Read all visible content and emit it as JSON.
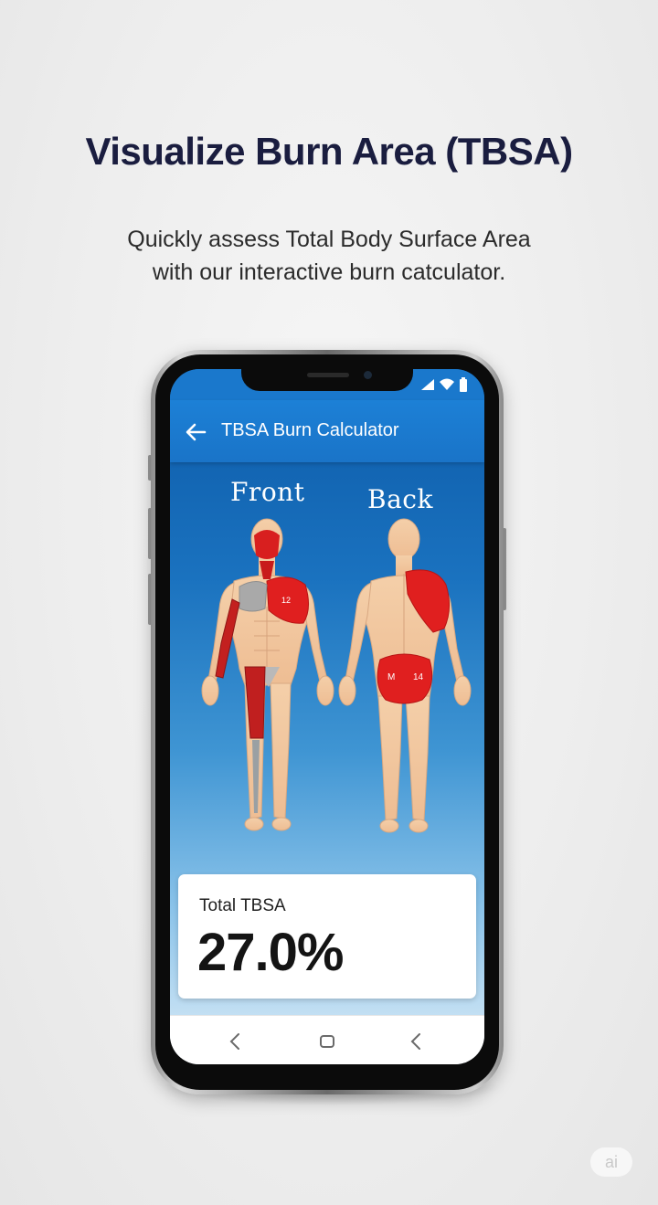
{
  "marketing": {
    "headline": "Visualize Burn Area (TBSA)",
    "subline_1": "Quickly assess Total Body Surface Area",
    "subline_2": "with our interactive burn catculator."
  },
  "app": {
    "title": "TBSA Burn Calculator",
    "back_icon": "arrow-left-icon",
    "status_icons": [
      "signal-icon",
      "wifi-icon",
      "battery-icon"
    ]
  },
  "body_map": {
    "front_label": "Front",
    "back_label": "Back",
    "front_chest_badge": "12",
    "back_buttock_left_badge": "M",
    "back_buttock_right_badge": "14",
    "burn_color": "#e01f1f",
    "skin_color": "#f2c9a3"
  },
  "result": {
    "label": "Total TBSA",
    "value": "27.0%"
  },
  "nav": {
    "icons": [
      "back-chevron-icon",
      "home-square-icon",
      "recents-chevron-icon"
    ]
  },
  "watermark": "ai"
}
